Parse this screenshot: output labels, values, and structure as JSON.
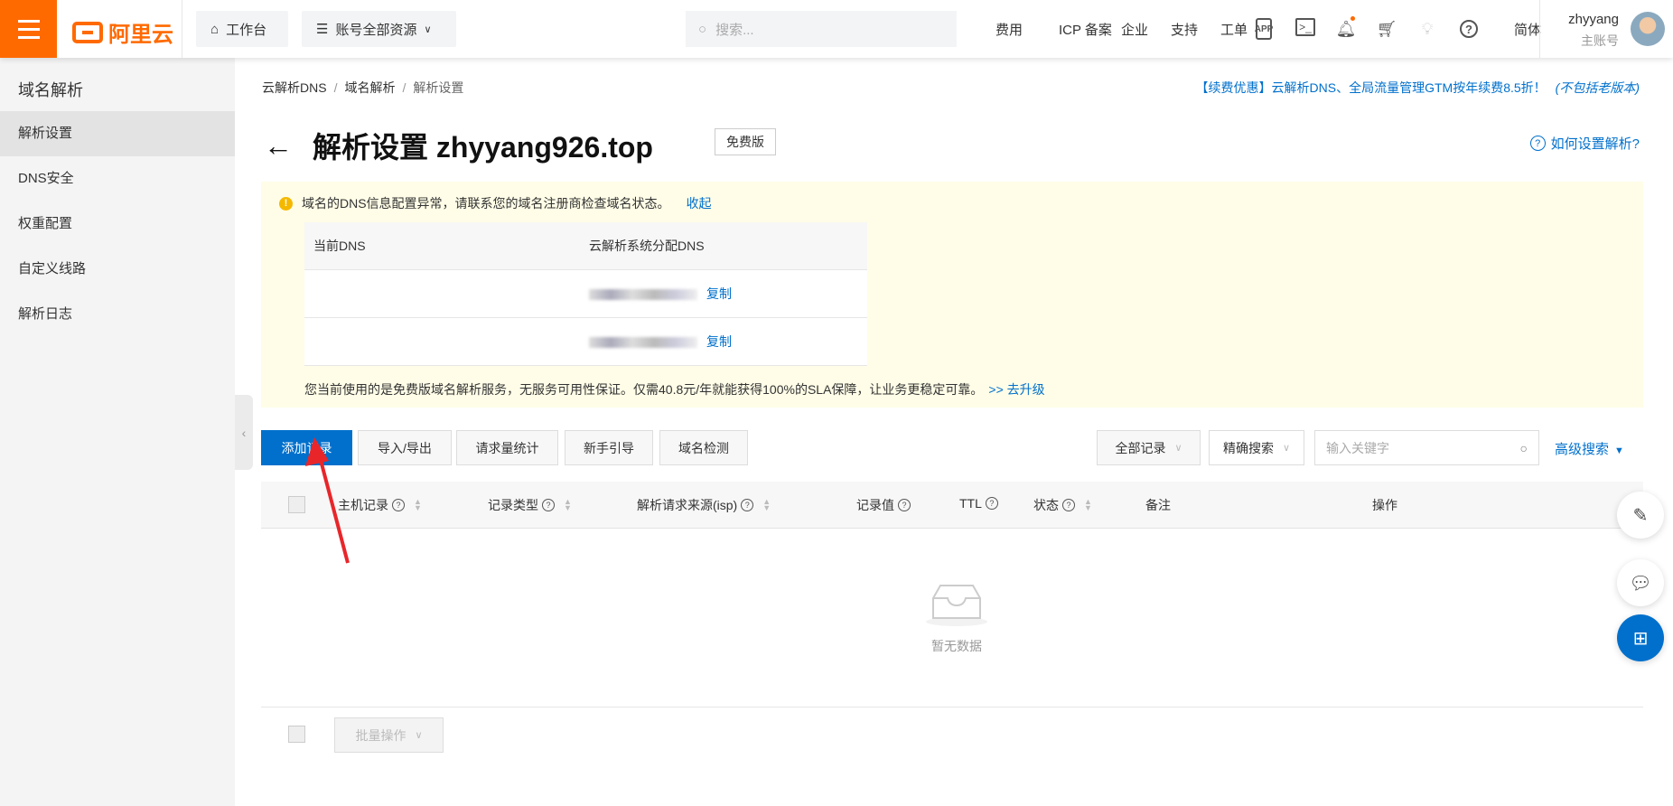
{
  "header": {
    "logo": "阿里云",
    "workbench": "工作台",
    "resources": "账号全部资源",
    "search_placeholder": "搜索...",
    "nav": [
      "费用",
      "ICP 备案",
      "企业",
      "支持",
      "工单"
    ],
    "lang": "简体",
    "username": "zhyyang",
    "account_type": "主账号",
    "icons": [
      "app-icon",
      "terminal-icon",
      "bell-icon",
      "cart-icon",
      "bulb-icon",
      "help-icon"
    ]
  },
  "sidebar": {
    "title": "域名解析",
    "items": [
      {
        "label": "解析设置",
        "active": true
      },
      {
        "label": "DNS安全"
      },
      {
        "label": "权重配置"
      },
      {
        "label": "自定义线路"
      },
      {
        "label": "解析日志"
      }
    ]
  },
  "breadcrumb": [
    "云解析DNS",
    "域名解析",
    "解析设置"
  ],
  "promo": {
    "text": "【续费优惠】云解析DNS、全局流量管理GTM按年续费8.5折！",
    "note": "(不包括老版本)"
  },
  "page": {
    "title": "解析设置 zhyyang926.top",
    "badge": "免费版",
    "help": "如何设置解析?"
  },
  "warning": {
    "message": "域名的DNS信息配置异常，请联系您的域名注册商检查域名状态。",
    "collapse": "收起",
    "table_headers": [
      "当前DNS",
      "云解析系统分配DNS"
    ],
    "copy": "复制",
    "upgrade_text": "您当前使用的是免费版域名解析服务，无服务可用性保证。仅需40.8元/年就能获得100%的SLA保障，让业务更稳定可靠。",
    "upgrade_link": ">> 去升级"
  },
  "toolbar": {
    "buttons": [
      "添加记录",
      "导入/导出",
      "请求量统计",
      "新手引导",
      "域名检测"
    ],
    "filter": "全部记录",
    "search_mode": "精确搜索",
    "keyword_placeholder": "输入关键字",
    "advanced": "高级搜索"
  },
  "table": {
    "headers": [
      "主机记录",
      "记录类型",
      "解析请求来源(isp)",
      "记录值",
      "TTL",
      "状态",
      "备注",
      "操作"
    ],
    "empty": "暂无数据"
  },
  "footer": {
    "batch": "批量操作"
  },
  "colors": {
    "brand": "#ff6a00",
    "primary": "#0070cc"
  }
}
